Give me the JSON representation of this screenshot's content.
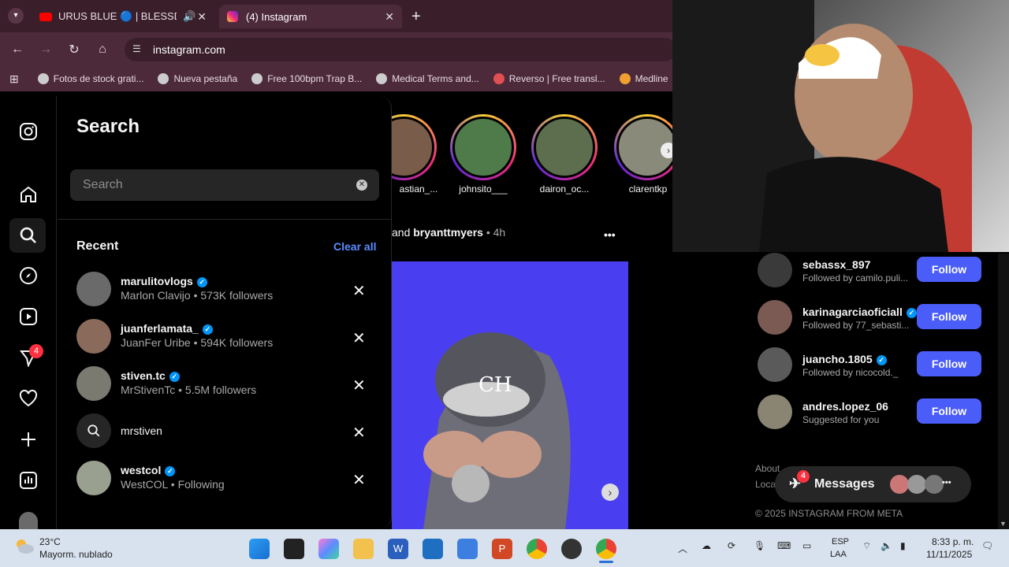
{
  "browser": {
    "tabs": [
      {
        "label": "URUS BLUE 🔵 | BLESSD (",
        "audio": true
      },
      {
        "label": "(4) Instagram",
        "active": true
      }
    ],
    "url": "instagram.com",
    "bookmarks": [
      "Fotos de stock grati...",
      "Nueva pestaña",
      "Free 100bpm Trap B...",
      "Medical Terms and...",
      "Reverso | Free transl...",
      "Medline"
    ]
  },
  "search": {
    "title": "Search",
    "placeholder": "Search",
    "recent_label": "Recent",
    "clear_all": "Clear all",
    "items": [
      {
        "name": "marulitovlogs",
        "sub": "Marlon Clavijo • 573K followers",
        "verified": true
      },
      {
        "name": "juanferlamata_",
        "sub": "JuanFer Uribe • 594K followers",
        "verified": true
      },
      {
        "name": "stiven.tc",
        "sub": "MrStivenTc • 5.5M followers",
        "verified": true
      },
      {
        "name": "mrstiven",
        "sub": "",
        "verified": false,
        "is_query": true
      },
      {
        "name": "westcol",
        "sub": "WestCOL • Following",
        "verified": true
      }
    ]
  },
  "nav": {
    "notification_badge": "4"
  },
  "stories": [
    "astian_...",
    "johnsito___",
    "dairon_oc...",
    "clarentkp"
  ],
  "post": {
    "header_text": "and",
    "author": "bryanttmyers",
    "time": "• 4h",
    "more": "•••"
  },
  "suggestions": [
    {
      "name": "sebassx_897",
      "sub": "Followed by camilo.puli...",
      "verified": false,
      "button": "Follow"
    },
    {
      "name": "karinagarciaoficiall",
      "sub": "Followed by 77_sebasti...",
      "verified": true,
      "button": "Follow"
    },
    {
      "name": "juancho.1805",
      "sub": "Followed by nicocold._",
      "verified": true,
      "button": "Follow"
    },
    {
      "name": "andres.lopez_06",
      "sub": "Suggested for you",
      "verified": false,
      "button": "Follow"
    }
  ],
  "footer": {
    "about": "About",
    "loca": "Loca",
    "copyright": "© 2025 INSTAGRAM FROM META"
  },
  "messages": {
    "label": "Messages",
    "badge": "4",
    "more": "•••"
  },
  "taskbar": {
    "weather_temp": "23°C",
    "weather_desc": "Mayorm. nublado",
    "lang1": "ESP",
    "lang2": "LAA",
    "time": "8:33 p. m.",
    "date": "11/11/2025"
  }
}
